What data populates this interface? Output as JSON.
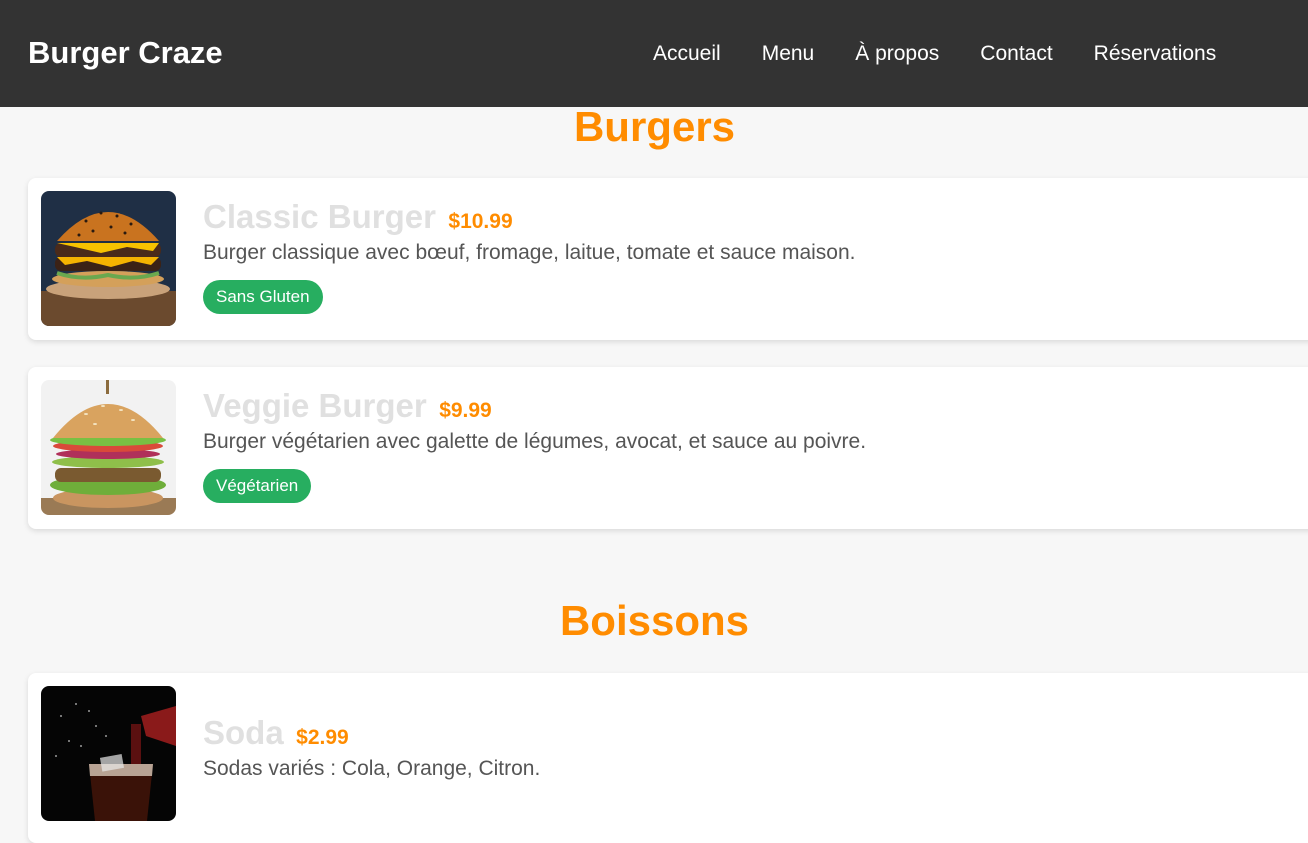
{
  "header": {
    "brand": "Burger Craze",
    "nav": [
      "Accueil",
      "Menu",
      "À propos",
      "Contact",
      "Réservations"
    ]
  },
  "sections": [
    {
      "title": "Burgers",
      "items": [
        {
          "name": "Classic Burger",
          "price": "$10.99",
          "description": "Burger classique avec bœuf, fromage, laitue, tomate et sauce maison.",
          "badge": "Sans Gluten",
          "image_icon": "classic-burger-photo"
        },
        {
          "name": "Veggie Burger",
          "price": "$9.99",
          "description": "Burger végétarien avec galette de légumes, avocat, et sauce au poivre.",
          "badge": "Végétarien",
          "image_icon": "veggie-burger-photo"
        }
      ]
    },
    {
      "title": "Boissons",
      "items": [
        {
          "name": "Soda",
          "price": "$2.99",
          "description": "Sodas variés : Cola, Orange, Citron.",
          "image_icon": "soda-photo"
        }
      ]
    }
  ],
  "colors": {
    "header_bg": "#333333",
    "accent": "#ff8c00",
    "badge_green": "#27ae60",
    "item_name": "#e0e0e0",
    "description": "#555555"
  }
}
